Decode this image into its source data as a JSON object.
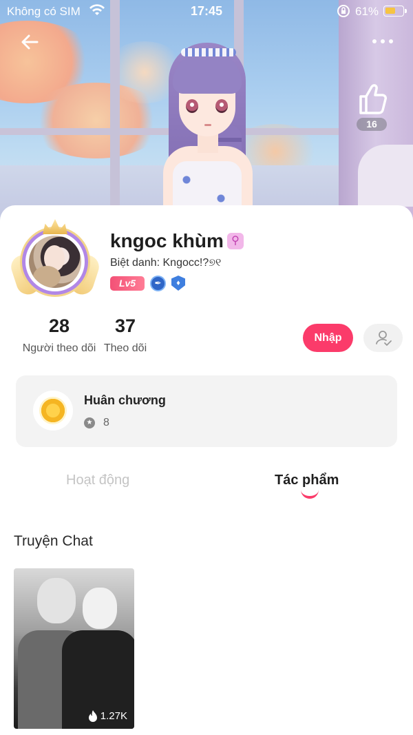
{
  "status_bar": {
    "carrier": "Không có SIM",
    "time": "17:45",
    "battery_percent": "61%",
    "battery_level": 0.61
  },
  "header": {
    "like_count": "16"
  },
  "profile": {
    "username": "kngoc khùm",
    "gender_icon": "⚲",
    "nickname": "Biệt danh: Kngocc!?୭୧",
    "level": "Lv5",
    "followers_count": "28",
    "followers_label": "Người theo dõi",
    "following_count": "37",
    "following_label": "Theo dõi"
  },
  "actions": {
    "join_label": "Nhập"
  },
  "medals": {
    "title": "Huân chương",
    "count": "8"
  },
  "tabs": [
    {
      "label": "Hoạt động",
      "active": false
    },
    {
      "label": "Tác phẩm",
      "active": true
    }
  ],
  "works": {
    "section_title": "Truyện Chat",
    "items": [
      {
        "views": "1.27K"
      }
    ]
  },
  "colors": {
    "accent": "#fb3b6a",
    "level_badge": "#f35176",
    "avatar_ring": "#b187e6"
  }
}
